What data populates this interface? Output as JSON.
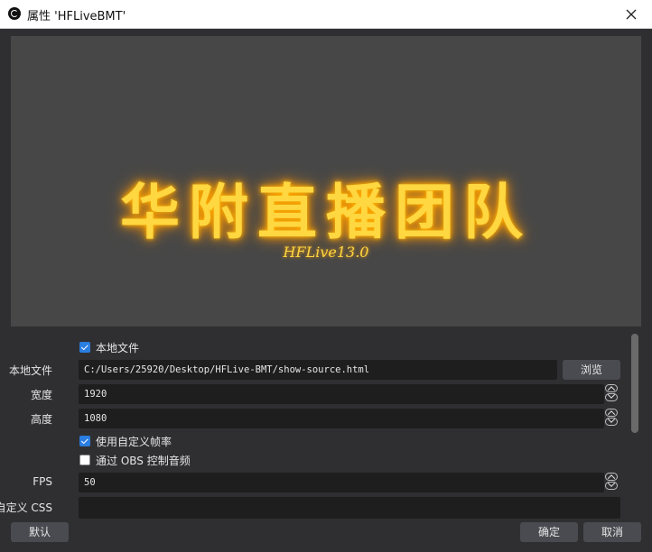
{
  "window": {
    "title": "属性 'HFLiveBMT'",
    "icon": "obs-logo-icon"
  },
  "preview": {
    "title": "华附直播团队",
    "subtitle": "HFLive13.0",
    "glow_color": "#ffd740",
    "background": "#474747"
  },
  "properties": {
    "local_file_checkbox": {
      "label": "本地文件",
      "checked": true
    },
    "local_file": {
      "label": "本地文件",
      "value": "C:/Users/25920/Desktop/HFLive-BMT/show-source.html",
      "browse_label": "浏览"
    },
    "width": {
      "label": "宽度",
      "value": "1920"
    },
    "height": {
      "label": "高度",
      "value": "1080"
    },
    "custom_fps_checkbox": {
      "label": "使用自定义帧率",
      "checked": true
    },
    "obs_audio_checkbox": {
      "label": "通过 OBS 控制音频",
      "checked": false
    },
    "fps": {
      "label": "FPS",
      "value": "50"
    },
    "custom_css": {
      "label": "自定义 CSS",
      "value": ""
    }
  },
  "footer": {
    "defaults_label": "默认",
    "ok_label": "确定",
    "cancel_label": "取消"
  },
  "colors": {
    "accent": "#2a7de1",
    "panel": "#2f2f32",
    "field": "#1e1e1e",
    "button": "#494b50"
  }
}
